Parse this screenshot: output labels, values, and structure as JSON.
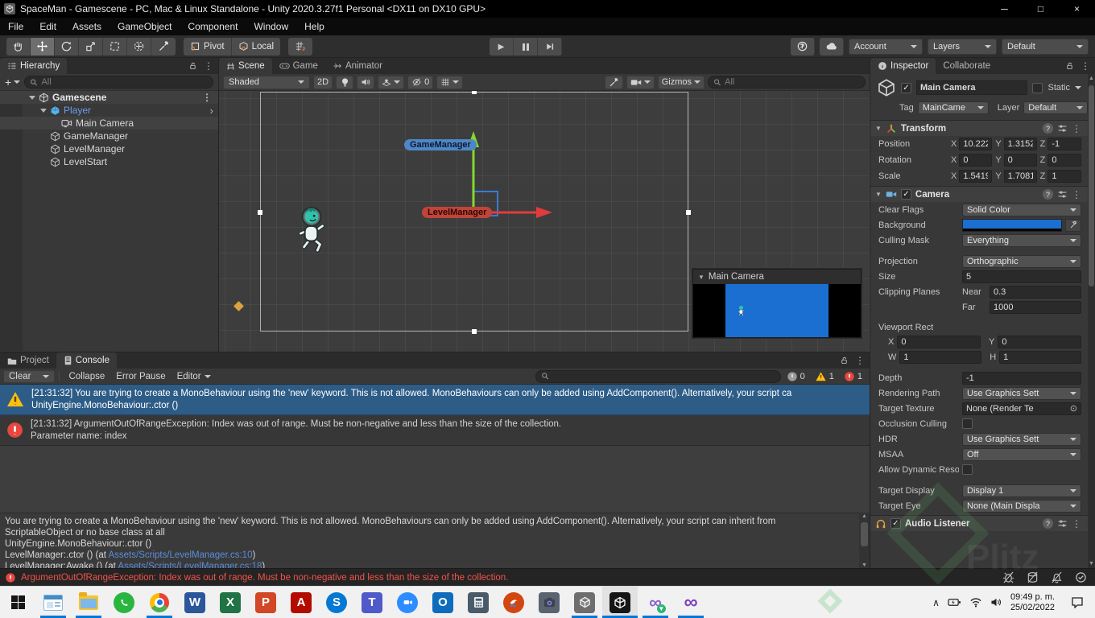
{
  "window": {
    "title": "SpaceMan - Gamescene - PC, Mac & Linux Standalone - Unity 2020.3.27f1 Personal <DX11 on DX10 GPU>"
  },
  "menu": [
    "File",
    "Edit",
    "Assets",
    "GameObject",
    "Component",
    "Window",
    "Help"
  ],
  "toolbar": {
    "pivot": "Pivot",
    "local": "Local",
    "account": "Account",
    "layers": "Layers",
    "layout": "Default"
  },
  "hierarchy": {
    "tab": "Hierarchy",
    "search_placeholder": "All",
    "scene": "Gamescene",
    "items": [
      {
        "label": "Player"
      },
      {
        "label": "Main Camera"
      },
      {
        "label": "GameManager"
      },
      {
        "label": "LevelManager"
      },
      {
        "label": "LevelStart"
      }
    ]
  },
  "scene": {
    "tabs": [
      "Scene",
      "Game",
      "Animator"
    ],
    "shading": "Shaded",
    "mode2d": "2D",
    "hidden_count": "0",
    "gizmos": "Gizmos",
    "search_placeholder": "All",
    "label_gamemanager": "GameManager",
    "label_levelmanager": "LevelManager",
    "camera_preview_title": "Main Camera"
  },
  "inspector": {
    "tab": "Inspector",
    "tab2": "Collaborate",
    "name": "Main Camera",
    "static_label": "Static",
    "tag_label": "Tag",
    "tag": "MainCame",
    "layer_label": "Layer",
    "layer": "Default",
    "transform": {
      "title": "Transform",
      "position_label": "Position",
      "rotation_label": "Rotation",
      "scale_label": "Scale",
      "x": "X",
      "y": "Y",
      "z": "Z",
      "px": "10.222",
      "py": "1.3152",
      "pz": "-1",
      "rx": "0",
      "ry": "0",
      "rz": "0",
      "sx": "1.5419",
      "sy": "1.7081",
      "sz": "1"
    },
    "camera": {
      "title": "Camera",
      "clear_flags_label": "Clear Flags",
      "clear_flags": "Solid Color",
      "background_label": "Background",
      "background_color": "#1b6fd0",
      "culling_mask_label": "Culling Mask",
      "culling_mask": "Everything",
      "projection_label": "Projection",
      "projection": "Orthographic",
      "size_label": "Size",
      "size": "5",
      "clipping_label": "Clipping Planes",
      "near_label": "Near",
      "near": "0.3",
      "far_label": "Far",
      "far": "1000",
      "viewport_label": "Viewport Rect",
      "vx_label": "X",
      "vx": "0",
      "vy_label": "Y",
      "vy": "0",
      "vw_label": "W",
      "vw": "1",
      "vh_label": "H",
      "vh": "1",
      "depth_label": "Depth",
      "depth": "-1",
      "rendering_path_label": "Rendering Path",
      "rendering_path": "Use Graphics Sett",
      "target_texture_label": "Target Texture",
      "target_texture": "None (Render Te",
      "occlusion_label": "Occlusion Culling",
      "hdr_label": "HDR",
      "hdr": "Use Graphics Sett",
      "msaa_label": "MSAA",
      "msaa": "Off",
      "dynamic_res_label": "Allow Dynamic Resol",
      "target_display_label": "Target Display",
      "target_display": "Display 1",
      "target_eye_label": "Target Eye",
      "target_eye": "None (Main Displa"
    },
    "audio_listener": {
      "title": "Audio Listener"
    }
  },
  "console": {
    "tab_project": "Project",
    "tab_console": "Console",
    "clear": "Clear",
    "collapse": "Collapse",
    "error_pause": "Error Pause",
    "editor": "Editor",
    "counts": {
      "info": "0",
      "warnings": "1",
      "errors": "1"
    },
    "entries": [
      {
        "line1": "[21:31:32] You are trying to create a MonoBehaviour using the 'new' keyword.  This is not allowed.  MonoBehaviours can only be added using AddComponent(). Alternatively, your script ca",
        "line2": "UnityEngine.MonoBehaviour:.ctor ()"
      },
      {
        "line1": "[21:31:32] ArgumentOutOfRangeException: Index was out of range. Must be non-negative and less than the size of the collection.",
        "line2": "Parameter name: index"
      }
    ],
    "detail": {
      "line1": "You are trying to create a MonoBehaviour using the 'new' keyword.  This is not allowed.  MonoBehaviours can only be added using AddComponent(). Alternatively, your script can inherit from",
      "line2": "ScriptableObject or no base class at all",
      "line3": "UnityEngine.MonoBehaviour:.ctor ()",
      "line4_pre": "LevelManager:.ctor () (at ",
      "line4_link": "Assets/Scripts/LevelManager.cs:10",
      "line4_post": ")",
      "line5_pre": "LevelManager:Awake () (at ",
      "line5_link": "Assets/Scripts/LevelManager.cs:18",
      "line5_post": ")"
    },
    "status_error": "ArgumentOutOfRangeException: Index was out of range. Must be non-negative and less than the size of the collection."
  },
  "taskbar": {
    "time": "09:49 p. m.",
    "date": "25/02/2022"
  },
  "icons": {
    "kebab": "⋮",
    "disclosure": "▼",
    "play": "▶",
    "chevron_right": "›",
    "check": "✓",
    "question": "?",
    "picker": "⊙",
    "chevron_up": "∧",
    "plus": "+",
    "minimize": "─",
    "maximize": "□",
    "close": "×",
    "up_arrow": "▲",
    "down_arrow": "▼"
  },
  "colors": {
    "selection_blue": "#2d5c87",
    "camera_background_blue": "#1b6fd0",
    "prefab_text_blue": "#6b9eea",
    "error_red": "#f25248",
    "warning_yellow": "#fdc00f",
    "taskbar_accent": "#0177d7"
  }
}
